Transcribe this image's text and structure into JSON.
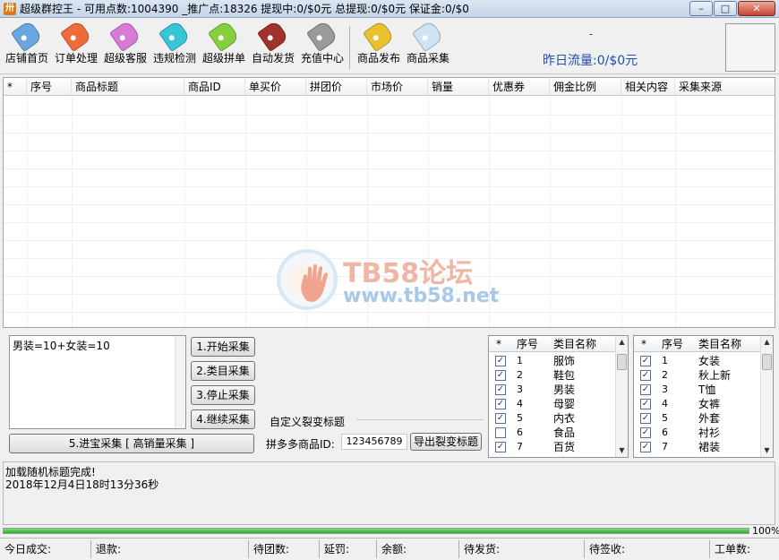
{
  "window": {
    "title": "超级群控王 - 可用点数:1004390 _推广点:18326 提现中:0/$0元 总提现:0/$0元 保证金:0/$0",
    "icon_char": "卅",
    "min": "–",
    "max": "□",
    "close": "✕"
  },
  "toolbar": {
    "items": [
      {
        "label": "店铺首页",
        "color": "#6aa6e0",
        "icon": "tag-icon"
      },
      {
        "label": "订单处理",
        "color": "#ef6b3a",
        "icon": "tag-icon"
      },
      {
        "label": "超级客服",
        "color": "#d77ad8",
        "icon": "tag-icon"
      },
      {
        "label": "违规检测",
        "color": "#36c6d6",
        "icon": "tag-icon"
      },
      {
        "label": "超级拼单",
        "color": "#86cf3c",
        "icon": "tag-icon"
      },
      {
        "label": "自动发货",
        "color": "#a0322a",
        "icon": "tag-icon"
      },
      {
        "label": "充值中心",
        "color": "#9a9a9a",
        "icon": "tag-icon"
      },
      {
        "label": "商品发布",
        "color": "#e8c22e",
        "icon": "tag-icon"
      },
      {
        "label": "商品采集",
        "color": "#cfe3f2",
        "icon": "tag-icon"
      }
    ],
    "traffic_dash": "-",
    "traffic_label": "昨日流量:0/$0元"
  },
  "grid": {
    "columns": [
      "*",
      "序号",
      "商品标题",
      "商品ID",
      "单买价",
      "拼团价",
      "市场价",
      "销量",
      "优惠券",
      "佣金比例",
      "相关内容",
      "采集来源"
    ]
  },
  "watermark": {
    "line1": "TB58论坛",
    "line2": "www.tb58.net"
  },
  "collect": {
    "keywords": "男装=10+女装=10",
    "btn_start": "1.开始采集",
    "btn_category": "2.类目采集",
    "btn_stop": "3.停止采集",
    "btn_continue": "4.继续采集",
    "btn_jinbao": "5.进宝采集 [ 高销量采集 ]"
  },
  "custom_title": {
    "section": "自定义裂变标题",
    "pdd_label": "拼多多商品ID:",
    "pdd_value": "123456789",
    "export_btn": "导出裂变标题"
  },
  "category_lists": [
    {
      "headers": [
        "*",
        "序号",
        "类目名称"
      ],
      "rows": [
        {
          "checked": true,
          "num": "1",
          "name": "服饰"
        },
        {
          "checked": true,
          "num": "2",
          "name": "鞋包"
        },
        {
          "checked": true,
          "num": "3",
          "name": "男装"
        },
        {
          "checked": true,
          "num": "4",
          "name": "母婴"
        },
        {
          "checked": true,
          "num": "5",
          "name": "内衣"
        },
        {
          "checked": false,
          "num": "6",
          "name": "食品"
        },
        {
          "checked": true,
          "num": "7",
          "name": "百货"
        }
      ]
    },
    {
      "headers": [
        "*",
        "序号",
        "类目名称"
      ],
      "rows": [
        {
          "checked": true,
          "num": "1",
          "name": "女装"
        },
        {
          "checked": true,
          "num": "2",
          "name": "秋上新"
        },
        {
          "checked": true,
          "num": "3",
          "name": "T恤"
        },
        {
          "checked": true,
          "num": "4",
          "name": "女裤"
        },
        {
          "checked": true,
          "num": "5",
          "name": "外套"
        },
        {
          "checked": true,
          "num": "6",
          "name": "衬衫"
        },
        {
          "checked": true,
          "num": "7",
          "name": "裙装"
        }
      ]
    }
  ],
  "log": {
    "line1": "加载随机标题完成!",
    "line2": "2018年12月4日18时13分36秒"
  },
  "progress": {
    "percent": 100,
    "label": "100%"
  },
  "statusbar": {
    "today_deals": "今日成交:",
    "refund": "退款:",
    "pending_group": "待团数:",
    "delay_penalty": "延罚:",
    "balance": "余额:",
    "pending_ship": "待发货:",
    "pending_receive": "待签收:",
    "ticket_count": "工单数:"
  }
}
